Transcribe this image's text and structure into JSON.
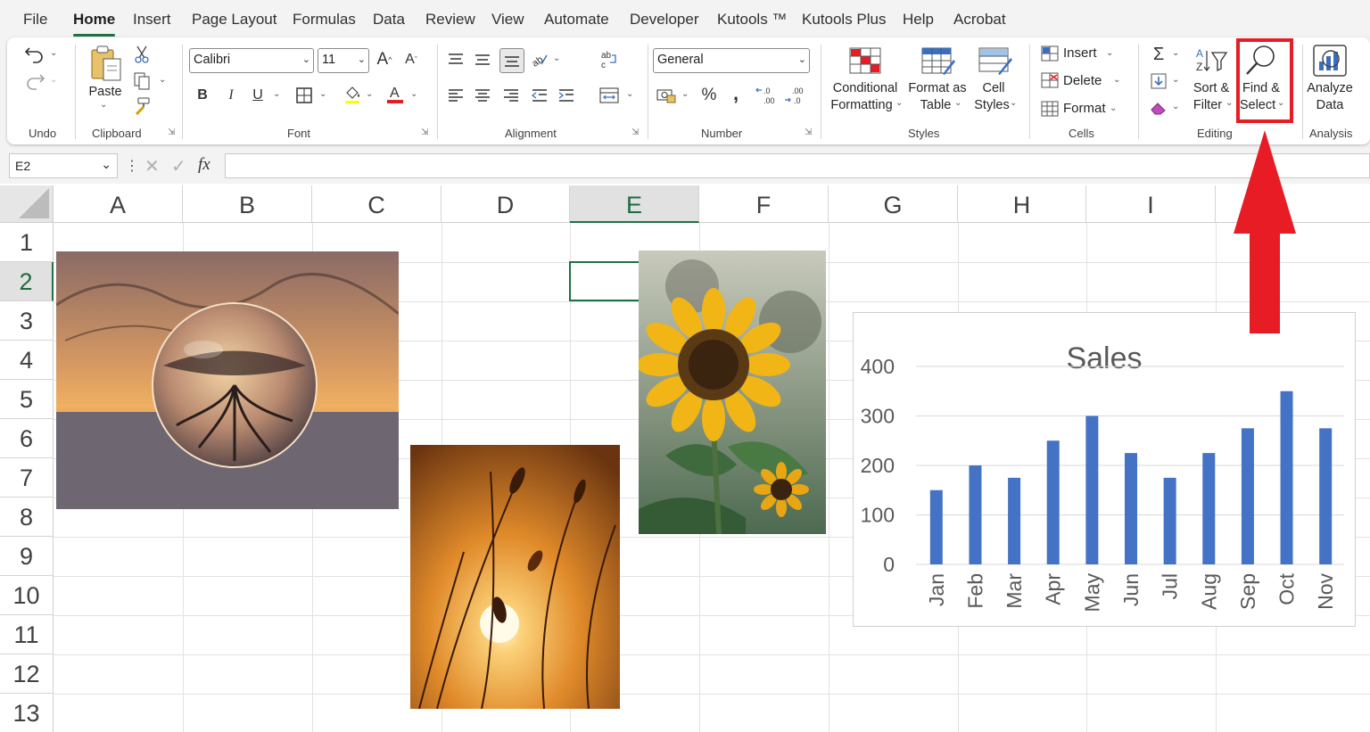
{
  "tabs": [
    "File",
    "Home",
    "Insert",
    "Page Layout",
    "Formulas",
    "Data",
    "Review",
    "View",
    "Automate",
    "Developer",
    "Kutools ™",
    "Kutools Plus",
    "Help",
    "Acrobat"
  ],
  "active_tab": "Home",
  "ribbon": {
    "groups": {
      "undo": "Undo",
      "clipboard": "Clipboard",
      "font": "Font",
      "alignment": "Alignment",
      "number": "Number",
      "styles": "Styles",
      "cells": "Cells",
      "editing": "Editing",
      "analysis": "Analysis"
    },
    "paste_label": "Paste",
    "font_name": "Calibri",
    "font_size": "11",
    "number_format": "General",
    "conditional_formatting": [
      "Conditional",
      "Formatting"
    ],
    "format_as_table": [
      "Format as",
      "Table"
    ],
    "cell_styles": [
      "Cell",
      "Styles"
    ],
    "cells_items": [
      "Insert",
      "Delete",
      "Format"
    ],
    "sort_filter": [
      "Sort &",
      "Filter"
    ],
    "find_select": [
      "Find &",
      "Select"
    ],
    "analyze_data": [
      "Analyze",
      "Data"
    ],
    "bold": "B",
    "italic": "I",
    "underline": "U",
    "percent": "%",
    "comma": "Ι",
    "fx": "fx"
  },
  "name_box": "E2",
  "formula_value": "",
  "columns": [
    "A",
    "B",
    "C",
    "D",
    "E",
    "F",
    "G",
    "H",
    "I"
  ],
  "rows": [
    "1",
    "2",
    "3",
    "4",
    "5",
    "6",
    "7",
    "8",
    "9",
    "10",
    "11",
    "12",
    "13"
  ],
  "selected_cell": {
    "column": "E",
    "row": "2"
  },
  "annotation": {
    "color": "#e81c24",
    "target": "Find & Select"
  },
  "chart_data": {
    "type": "bar",
    "title": "Sales",
    "categories": [
      "Jan",
      "Feb",
      "Mar",
      "Apr",
      "May",
      "Jun",
      "Jul",
      "Aug",
      "Sep",
      "Oct",
      "Nov"
    ],
    "values": [
      150,
      200,
      175,
      250,
      300,
      225,
      175,
      225,
      275,
      350,
      275
    ],
    "yticks": [
      "0",
      "100",
      "200",
      "300",
      "400"
    ],
    "ylim": [
      0,
      400
    ],
    "xlabel": "",
    "ylabel": "",
    "grid": true,
    "bar_color": "#4472c4"
  },
  "accent_color": "#1e7145"
}
